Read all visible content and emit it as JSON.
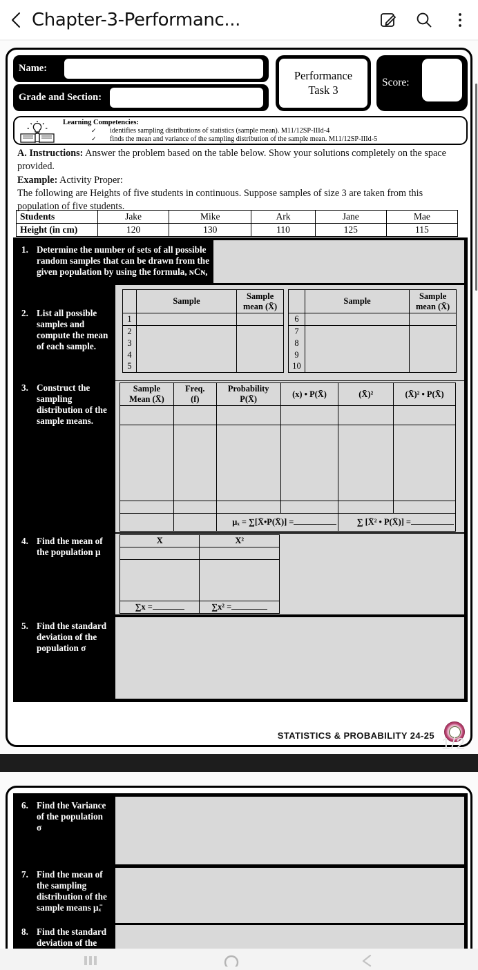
{
  "appbar": {
    "back_icon": "chevron-left-icon",
    "title": "Chapter-3-Performanc...",
    "edit_icon": "edit-pencil-icon",
    "search_icon": "search-icon",
    "overflow_icon": "more-vertical-icon"
  },
  "header": {
    "name_label": "Name:",
    "grade_label": "Grade and Section:",
    "performance_task": "Performance\nTask 3",
    "performance_task_line1": "Performance",
    "performance_task_line2": "Task 3",
    "score_label": "Score:"
  },
  "competencies": {
    "icon": "book-lightbulb-icon",
    "title": "Learning Competencies:",
    "items": [
      {
        "check": "✓",
        "text": "identifies sampling distributions of statistics (sample mean). M11/12SP-IIId-4"
      },
      {
        "check": "✓",
        "text": "finds the mean and variance of the sampling distribution of the sample mean. M11/12SP-IIId-5"
      }
    ]
  },
  "instructions": {
    "line_a_bold": "A. Instructions:",
    "line_a": " Answer the problem based on the table below. Show your solutions completely on the space provided.",
    "example_bold": "Example:",
    "example_rest": " Activity Proper:",
    "problem": "The following are Heights of five students in continuous. Suppose samples of size 3 are taken from this population of five students."
  },
  "students_table": {
    "row_labels": [
      "Students",
      "Height (in cm)"
    ],
    "names": [
      "Jake",
      "Mike",
      "Ark",
      "Jane",
      "Mae"
    ],
    "heights": [
      "120",
      "130",
      "110",
      "125",
      "115"
    ]
  },
  "questions": [
    {
      "num": "1.",
      "text": "Determine the number of sets of all possible random samples that can be drawn from the given population by using the formula, ɴCɴ,"
    },
    {
      "num": "2.",
      "text": "List all possible samples and compute the mean of each sample."
    },
    {
      "num": "3.",
      "text": "Construct the sampling distribution of the sample means."
    },
    {
      "num": "4.",
      "text": "Find the mean of the population μ"
    },
    {
      "num": "5.",
      "text": "Find the standard deviation of the population σ"
    },
    {
      "num": "6.",
      "text": "Find the Variance of the population σ"
    },
    {
      "num": "7.",
      "text": "Find the mean of the sampling distribution of the sample means μₓ̄"
    },
    {
      "num": "8.",
      "text": "Find the standard deviation of the"
    }
  ],
  "q2_table": {
    "headers_left": [
      "",
      "Sample",
      "Sample mean (X̄)"
    ],
    "headers_right": [
      "",
      "Sample",
      "Sample mean (X̄)"
    ],
    "header_sample": "Sample",
    "header_mean_l1": "Sample",
    "header_mean_l2": "mean (X̄)",
    "rows_left": [
      "1",
      "2",
      "3",
      "4",
      "5"
    ],
    "rows_right": [
      "6",
      "7",
      "8",
      "9",
      "10"
    ]
  },
  "q3_table": {
    "headers": [
      {
        "l1": "Sample",
        "l2": "Mean (X̄)"
      },
      {
        "l1": "Freq.",
        "l2": "(f)"
      },
      {
        "l1": "Probability",
        "l2": "P(X̄)"
      },
      {
        "l1": "(x) • P(X̄)",
        "l2": ""
      },
      {
        "l1": "(X̄)²",
        "l2": ""
      },
      {
        "l1": "(X̄)² • P(X̄)",
        "l2": ""
      }
    ],
    "totals": [
      "μₓ = ∑[X̄•P(X̄)] =",
      "∑ [X̄² • P(X̄)] ="
    ]
  },
  "q4_table": {
    "headers": [
      "X",
      "X²"
    ],
    "totals": [
      "∑x =",
      "∑x² ="
    ]
  },
  "footer": {
    "text": "STATISTICS & PROBABILITY 24-25",
    "seal": "school-seal-logo",
    "page_indicator": "1/2"
  },
  "navbar": {
    "recents_icon": "recents-icon",
    "home_icon": "home-icon",
    "back_icon": "back-arrow-icon"
  },
  "colors": {
    "accent_black": "#000000",
    "answer_fill": "#d9d9d9",
    "page_bg": "#ffffff",
    "seal": "#b8406e"
  }
}
